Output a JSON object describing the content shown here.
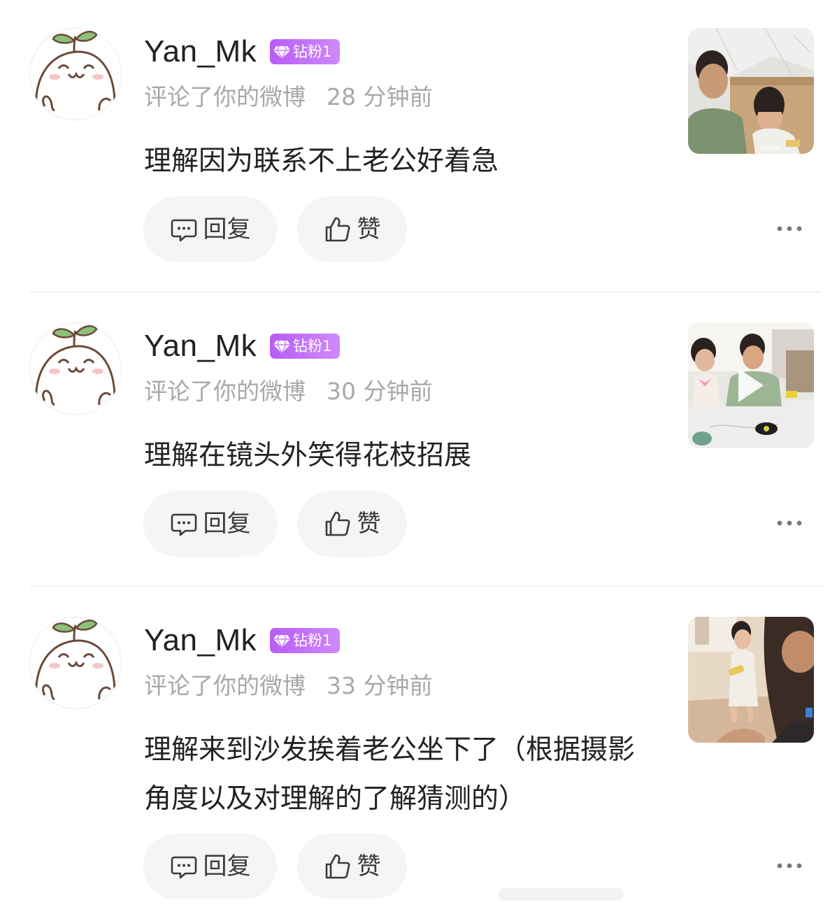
{
  "comments": [
    {
      "username": "Yan_Mk",
      "badge": "钻粉1",
      "action": "评论了你的微博",
      "time": "28 分钟前",
      "text": "理解因为联系不上老公好着急",
      "thumbnail_caption": "@礼貌龟",
      "has_video": false
    },
    {
      "username": "Yan_Mk",
      "badge": "钻粉1",
      "action": "评论了你的微博",
      "time": "30 分钟前",
      "text": "理解在镜头外笑得花枝招展",
      "has_video": true
    },
    {
      "username": "Yan_Mk",
      "badge": "钻粉1",
      "action": "评论了你的微博",
      "time": "33 分钟前",
      "text": "理解来到沙发挨着老公坐下了（根据摄影角度以及对理解的了解猜测的）",
      "has_video": false
    }
  ],
  "actions": {
    "reply_label": "回复",
    "like_label": "赞"
  },
  "icons": {
    "reply": "comment-bubble-icon",
    "like": "thumbs-up-icon",
    "more": "more-dots-icon",
    "badge": "diamond-icon",
    "play": "play-icon"
  },
  "colors": {
    "badge_purple": "#c073f8",
    "meta_gray": "#a8a8a8",
    "pill_bg": "#f5f5f5"
  }
}
